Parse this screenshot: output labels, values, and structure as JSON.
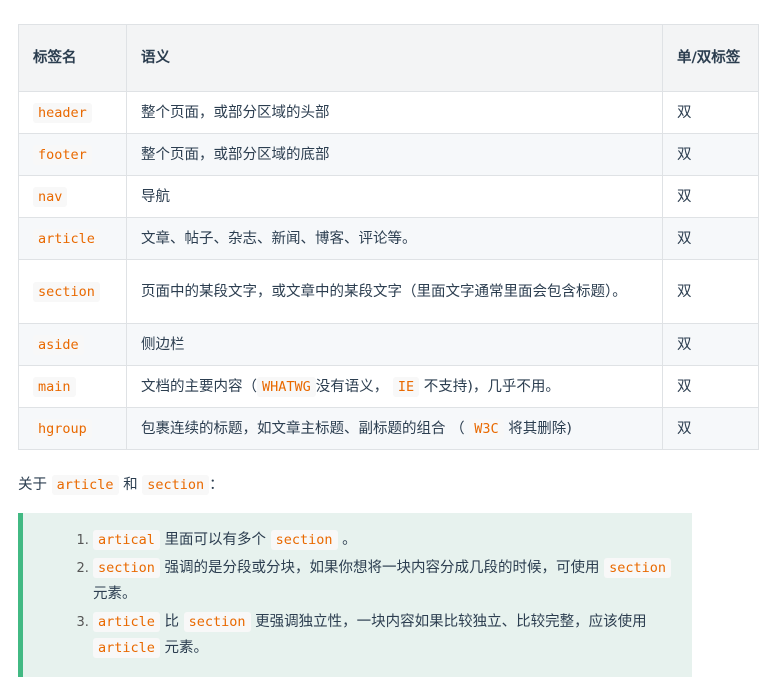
{
  "table": {
    "headers": [
      "标签名",
      "语义",
      "单/双标签"
    ],
    "rows": [
      {
        "tag": "header",
        "meaning": "整个页面，或部分区域的头部",
        "type": "双"
      },
      {
        "tag": "footer",
        "meaning": "整个页面，或部分区域的底部",
        "type": "双"
      },
      {
        "tag": "nav",
        "meaning": "导航",
        "type": "双"
      },
      {
        "tag": "article",
        "meaning": "文章、帖子、杂志、新闻、博客、评论等。",
        "type": "双"
      },
      {
        "tag": "section",
        "meaning": "页面中的某段文字，或文章中的某段文字（里面文字通常里面会包含标题）。",
        "type": "双"
      },
      {
        "tag": "aside",
        "meaning": "侧边栏",
        "type": "双"
      },
      {
        "tag": "main",
        "meaning_parts": [
          "文档的主要内容（",
          "WHATWG",
          "没有语义，",
          "IE",
          "不支持)，几乎不用。"
        ],
        "type": "双"
      },
      {
        "tag": "hgroup",
        "meaning_parts": [
          "包裹连续的标题，如文章主标题、副标题的组合 （",
          "W3C",
          "将其删除)"
        ],
        "type": "双"
      }
    ]
  },
  "intro": {
    "prefix": "关于",
    "code1": "article",
    "middle": "和",
    "code2": "section",
    "suffix": "："
  },
  "tip": {
    "items": [
      {
        "p1_code": "artical",
        "p2": "里面可以有多个",
        "p3_code": "section",
        "p4": "。"
      },
      {
        "p1_code": "section",
        "p2": "强调的是分段或分块，如果你想将一块内容分成几段的时候，可使用",
        "p3_code": "section",
        "p4": "元素。"
      },
      {
        "p1_code": "article",
        "p2": "比",
        "p3_code": "section",
        "p4": "更强调独立性，一块内容如果比较独立、比较完整，应该使用",
        "p5_code": "article",
        "p6": "元素。"
      }
    ]
  }
}
